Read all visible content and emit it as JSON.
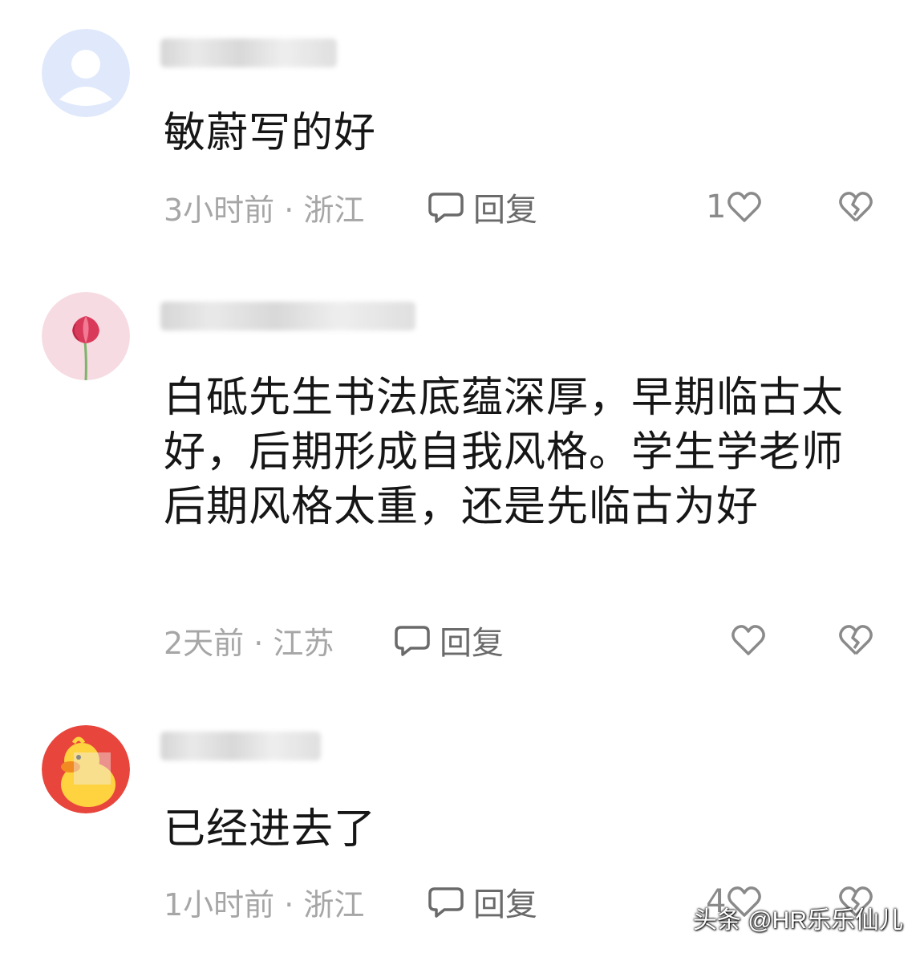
{
  "comments": [
    {
      "content": "敏蔚写的好",
      "meta": "3小时前 · 浙江",
      "reply_label": "回复",
      "like_count": "1",
      "avatar": "default-user-avatar"
    },
    {
      "content": "白砥先生书法底蕴深厚，早期临古太好，后期形成自我风格。学生学老师后期风格太重，还是先临古为好",
      "meta": "2天前 · 江苏",
      "reply_label": "回复",
      "like_count": "",
      "avatar": "tulip-avatar"
    },
    {
      "content": "已经进去了",
      "meta": "1小时前 · 浙江",
      "reply_label": "回复",
      "like_count": "4",
      "avatar": "cartoon-duck-avatar"
    }
  ],
  "watermark": "头条 @HR乐乐仙儿",
  "colors": {
    "meta_text": "#a6a6a6",
    "icon_gray": "#8a8a8a",
    "avatar_default_bg": "#dfe9fb",
    "tulip_bg": "#f6dbe2",
    "duck_bg": "#e8453c"
  }
}
